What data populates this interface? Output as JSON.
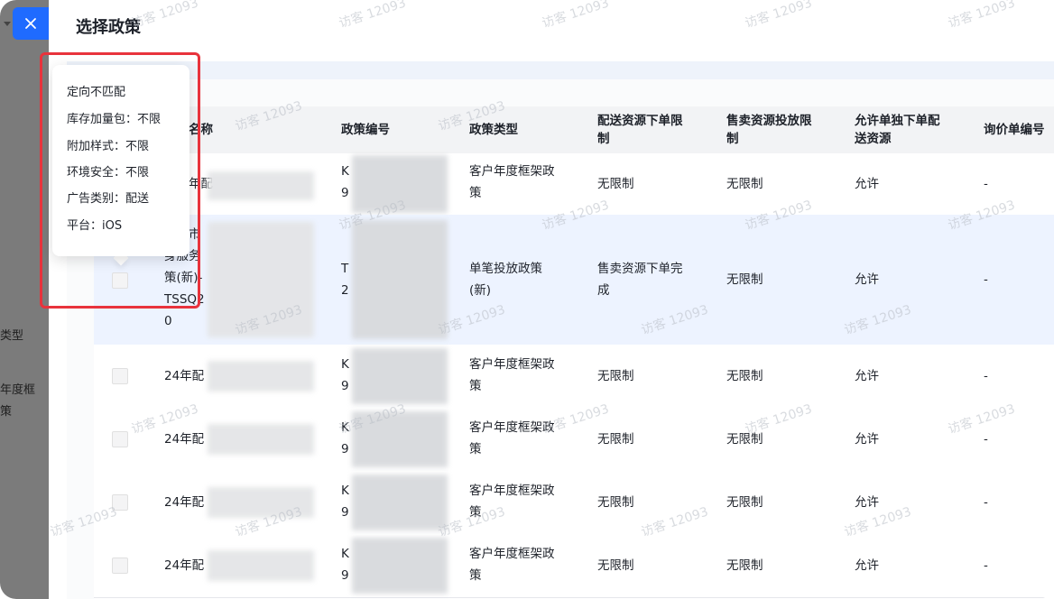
{
  "drawer": {
    "title": "选择政策"
  },
  "backdrop": {
    "label_type": "类型",
    "label_value_line1": "年度框",
    "label_value_line2": "策"
  },
  "table": {
    "headers": {
      "name": "名称",
      "code": "政策编号",
      "type": "政策类型",
      "delivery_limit_line1": "配送资源下单限",
      "delivery_limit_line2": "制",
      "sale_limit_line1": "售卖资源投放限",
      "sale_limit_line2": "制",
      "allow_line1": "允许单独下单配",
      "allow_line2": "送资源",
      "inquiry": "询价单编号"
    },
    "rows": [
      {
        "name": "年配",
        "code_a": "K",
        "code_b": "9",
        "type_l1": "客户年度框架政",
        "type_l2": "策",
        "delivery": "无限制",
        "sale": "无限制",
        "allow": "允许",
        "inquiry": "-"
      },
      {
        "name_l1": "市",
        "name_l2": "身服务",
        "name_l3": "策(新)-",
        "name_l4": "TSSQ2",
        "name_l5": "0",
        "code_a": "T",
        "code_b": "2",
        "type_l1": "单笔投放政策",
        "type_l2": "(新)",
        "delivery_l1": "售卖资源下单完",
        "delivery_l2": "成",
        "sale": "无限制",
        "allow": "允许",
        "inquiry": "-"
      },
      {
        "name": "24年配",
        "code_a": "K",
        "code_b": "9",
        "type_l1": "客户年度框架政",
        "type_l2": "策",
        "delivery": "无限制",
        "sale": "无限制",
        "allow": "允许",
        "inquiry": "-"
      },
      {
        "name": "24年配",
        "code_a": "K",
        "code_b": "9",
        "type_l1": "客户年度框架政",
        "type_l2": "策",
        "delivery": "无限制",
        "sale": "无限制",
        "allow": "允许",
        "inquiry": "-"
      },
      {
        "name": "24年配",
        "code_a": "K",
        "code_b": "9",
        "type_l1": "客户年度框架政",
        "type_l2": "策",
        "delivery": "无限制",
        "sale": "无限制",
        "allow": "允许",
        "inquiry": "-"
      },
      {
        "name": "24年配",
        "code_a": "K",
        "code_b": "9",
        "type_l1": "客户年度框架政",
        "type_l2": "策",
        "delivery": "无限制",
        "sale": "无限制",
        "allow": "允许",
        "inquiry": "-"
      }
    ]
  },
  "tooltip": {
    "lines": [
      "定向不匹配",
      "库存加量包：不限",
      "附加样式：不限",
      "环境安全：不限",
      "广告类别：配送",
      "平台：iOS"
    ]
  },
  "watermark": "访客 12093",
  "colors": {
    "primary": "#1f6bff",
    "highlight_border": "#e8333c",
    "header_bg": "#f2f3f5",
    "selected_row_bg": "#edf3ff"
  }
}
